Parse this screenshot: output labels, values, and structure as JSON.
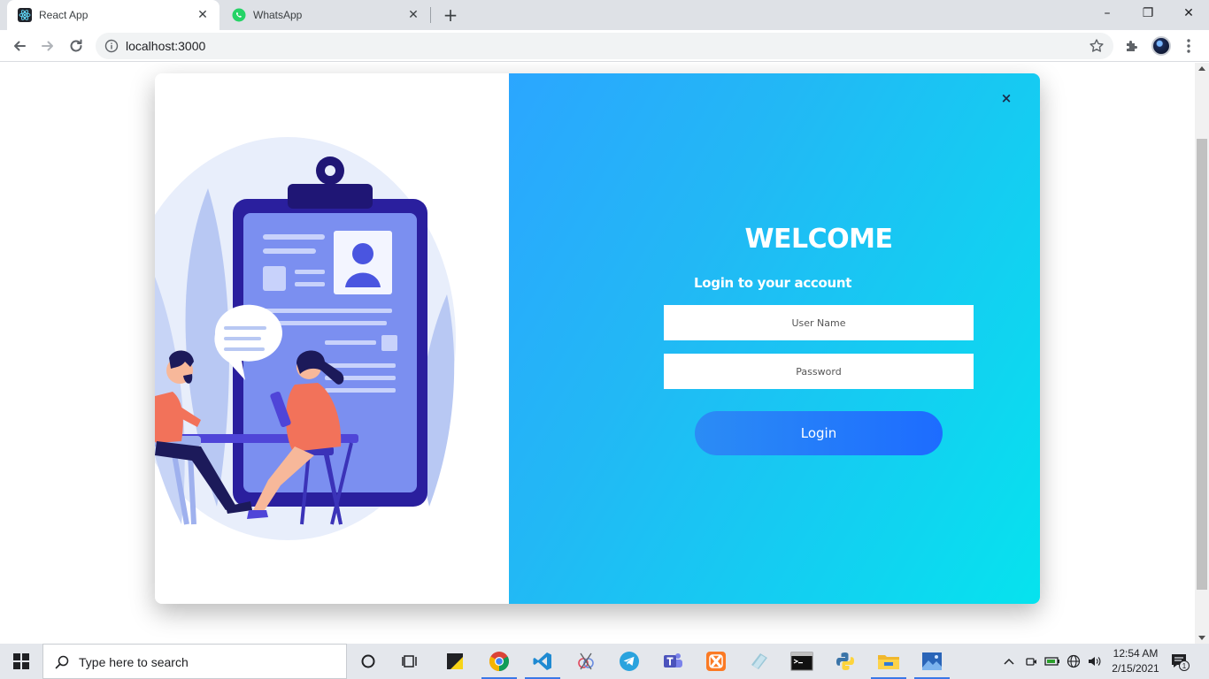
{
  "browser": {
    "tabs": [
      {
        "title": "React App",
        "active": true
      },
      {
        "title": "WhatsApp",
        "active": false
      }
    ],
    "url": "localhost:3000",
    "window_controls": {
      "minimize": "–",
      "restore": "❐",
      "close": "✕"
    }
  },
  "modal": {
    "close_label": "×",
    "welcome": "WELCOME",
    "subtitle": "Login to your account",
    "username_placeholder": "User Name",
    "password_placeholder": "Password",
    "login_label": "Login",
    "gradient": {
      "from": "#2ba6ff",
      "to": "#06e3ee"
    },
    "button_color": "#1d6cff"
  },
  "taskbar": {
    "search_placeholder": "Type here to search",
    "apps": [
      "cortana-icon",
      "task-view-icon",
      "sticky-notes-icon",
      "chrome-icon",
      "vscode-icon",
      "snipping-icon",
      "telegram-icon",
      "teams-icon",
      "xampp-icon",
      "files-icon",
      "terminal-icon",
      "python-icon",
      "file-explorer-icon",
      "photos-icon"
    ],
    "time": "12:54 AM",
    "date": "2/15/2021",
    "notification_count": "1"
  }
}
